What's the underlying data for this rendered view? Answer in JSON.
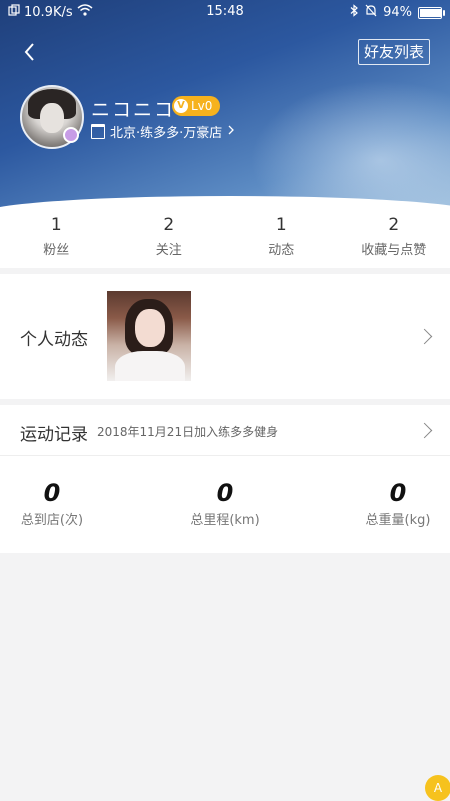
{
  "status_bar": {
    "network_speed": "10.9K/s",
    "time": "15:48",
    "battery": "94%",
    "battery_level": 0.94
  },
  "header": {
    "friends_list_label": "好友列表",
    "username": "ニコニコ",
    "level": "Lv0",
    "level_badge_letter": "V",
    "store": "北京·练多多·万豪店",
    "colors": {
      "level_badge": "#f6b21e",
      "header_top": "#1f3f7a"
    }
  },
  "stats": [
    {
      "value": "1",
      "label": "粉丝"
    },
    {
      "value": "2",
      "label": "关注"
    },
    {
      "value": "1",
      "label": "动态"
    },
    {
      "value": "2",
      "label": "收藏与点赞"
    }
  ],
  "feed": {
    "title": "个人动态"
  },
  "record": {
    "title": "运动记录",
    "joined": "2018年11月21日加入练多多健身",
    "metrics": [
      {
        "value": "0",
        "label": "总到店(次)"
      },
      {
        "value": "0",
        "label": "总里程(km)"
      },
      {
        "value": "0",
        "label": "总重量(kg)"
      }
    ]
  },
  "fab_label": "A"
}
